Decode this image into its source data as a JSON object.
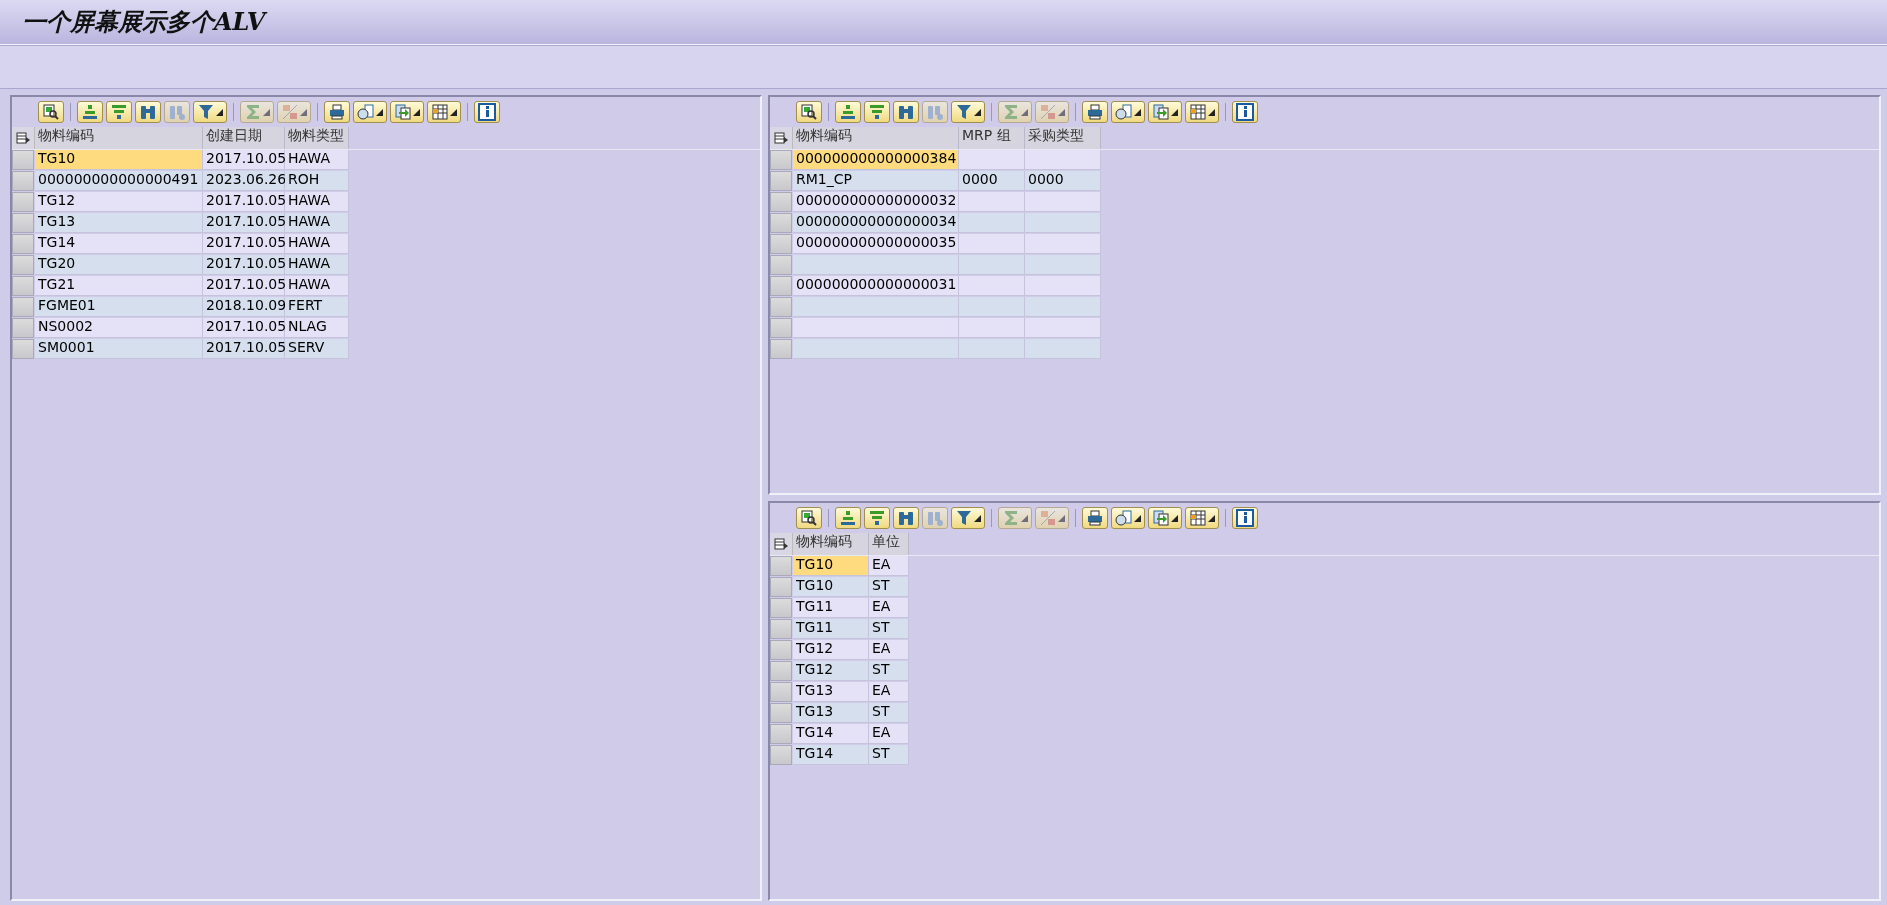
{
  "window": {
    "title": "一个屏幕展示多个ALV"
  },
  "grids": [
    {
      "toolbar": [
        {
          "kind": "details",
          "disabled": false,
          "menu": false
        },
        {
          "kind": "sort-up",
          "disabled": false,
          "menu": false
        },
        {
          "kind": "sort-down",
          "disabled": false,
          "menu": false
        },
        {
          "kind": "find",
          "disabled": false,
          "menu": false
        },
        {
          "kind": "find-next",
          "disabled": true,
          "menu": false
        },
        {
          "kind": "filter",
          "disabled": false,
          "menu": true
        },
        {
          "kind": "sum",
          "disabled": true,
          "menu": true
        },
        {
          "kind": "subtotal",
          "disabled": true,
          "menu": true
        },
        {
          "kind": "print",
          "disabled": false,
          "menu": false
        },
        {
          "kind": "view",
          "disabled": false,
          "menu": true
        },
        {
          "kind": "export",
          "disabled": false,
          "menu": true
        },
        {
          "kind": "layout",
          "disabled": false,
          "menu": true
        },
        {
          "kind": "info",
          "disabled": false,
          "menu": false
        }
      ],
      "columns": [
        "物料编码",
        "创建日期",
        "物料类型"
      ],
      "rows": [
        {
          "current": true,
          "cells": [
            "TG10",
            "2017.10.05",
            "HAWA"
          ]
        },
        {
          "current": false,
          "cells": [
            "000000000000000491",
            "2023.06.26",
            "ROH"
          ]
        },
        {
          "current": false,
          "cells": [
            "TG12",
            "2017.10.05",
            "HAWA"
          ]
        },
        {
          "current": false,
          "cells": [
            "TG13",
            "2017.10.05",
            "HAWA"
          ]
        },
        {
          "current": false,
          "cells": [
            "TG14",
            "2017.10.05",
            "HAWA"
          ]
        },
        {
          "current": false,
          "cells": [
            "TG20",
            "2017.10.05",
            "HAWA"
          ]
        },
        {
          "current": false,
          "cells": [
            "TG21",
            "2017.10.05",
            "HAWA"
          ]
        },
        {
          "current": false,
          "cells": [
            "FGME01",
            "2018.10.09",
            "FERT"
          ]
        },
        {
          "current": false,
          "cells": [
            "NS0002",
            "2017.10.05",
            "NLAG"
          ]
        },
        {
          "current": false,
          "cells": [
            "SM0001",
            "2017.10.05",
            "SERV"
          ]
        }
      ]
    },
    {
      "toolbar": [
        {
          "kind": "details",
          "disabled": false,
          "menu": false
        },
        {
          "kind": "sort-up",
          "disabled": false,
          "menu": false
        },
        {
          "kind": "sort-down",
          "disabled": false,
          "menu": false
        },
        {
          "kind": "find",
          "disabled": false,
          "menu": false
        },
        {
          "kind": "find-next",
          "disabled": true,
          "menu": false
        },
        {
          "kind": "filter",
          "disabled": false,
          "menu": true
        },
        {
          "kind": "sum",
          "disabled": true,
          "menu": true
        },
        {
          "kind": "subtotal",
          "disabled": true,
          "menu": true
        },
        {
          "kind": "print",
          "disabled": false,
          "menu": false
        },
        {
          "kind": "view",
          "disabled": false,
          "menu": true
        },
        {
          "kind": "export",
          "disabled": false,
          "menu": true
        },
        {
          "kind": "layout",
          "disabled": false,
          "menu": true
        },
        {
          "kind": "info",
          "disabled": false,
          "menu": false
        }
      ],
      "columns": [
        "物料编码",
        "MRP 组",
        "采购类型"
      ],
      "rows": [
        {
          "current": true,
          "cells": [
            "000000000000000384",
            "",
            ""
          ]
        },
        {
          "current": false,
          "cells": [
            "RM1_CP",
            "0000",
            "0000"
          ]
        },
        {
          "current": false,
          "cells": [
            "000000000000000032",
            "",
            ""
          ]
        },
        {
          "current": false,
          "cells": [
            "000000000000000034",
            "",
            ""
          ]
        },
        {
          "current": false,
          "cells": [
            "000000000000000035",
            "",
            ""
          ]
        },
        {
          "current": false,
          "cells": [
            "",
            "",
            ""
          ]
        },
        {
          "current": false,
          "cells": [
            "000000000000000031",
            "",
            ""
          ]
        },
        {
          "current": false,
          "cells": [
            "",
            "",
            ""
          ]
        },
        {
          "current": false,
          "cells": [
            "",
            "",
            ""
          ]
        },
        {
          "current": false,
          "cells": [
            "",
            "",
            ""
          ]
        }
      ]
    },
    {
      "toolbar": [
        {
          "kind": "details",
          "disabled": false,
          "menu": false
        },
        {
          "kind": "sort-up",
          "disabled": false,
          "menu": false
        },
        {
          "kind": "sort-down",
          "disabled": false,
          "menu": false
        },
        {
          "kind": "find",
          "disabled": false,
          "menu": false
        },
        {
          "kind": "find-next",
          "disabled": true,
          "menu": false
        },
        {
          "kind": "filter",
          "disabled": false,
          "menu": true
        },
        {
          "kind": "sum",
          "disabled": true,
          "menu": true
        },
        {
          "kind": "subtotal",
          "disabled": true,
          "menu": true
        },
        {
          "kind": "print",
          "disabled": false,
          "menu": false
        },
        {
          "kind": "view",
          "disabled": false,
          "menu": true
        },
        {
          "kind": "export",
          "disabled": false,
          "menu": true
        },
        {
          "kind": "layout",
          "disabled": false,
          "menu": true
        },
        {
          "kind": "info",
          "disabled": false,
          "menu": false
        }
      ],
      "columns": [
        "物料编码",
        "单位"
      ],
      "rows": [
        {
          "current": true,
          "cells": [
            "TG10",
            "EA"
          ]
        },
        {
          "current": false,
          "cells": [
            "TG10",
            "ST"
          ]
        },
        {
          "current": false,
          "cells": [
            "TG11",
            "EA"
          ]
        },
        {
          "current": false,
          "cells": [
            "TG11",
            "ST"
          ]
        },
        {
          "current": false,
          "cells": [
            "TG12",
            "EA"
          ]
        },
        {
          "current": false,
          "cells": [
            "TG12",
            "ST"
          ]
        },
        {
          "current": false,
          "cells": [
            "TG13",
            "EA"
          ]
        },
        {
          "current": false,
          "cells": [
            "TG13",
            "ST"
          ]
        },
        {
          "current": false,
          "cells": [
            "TG14",
            "EA"
          ]
        },
        {
          "current": false,
          "cells": [
            "TG14",
            "ST"
          ]
        }
      ]
    }
  ]
}
